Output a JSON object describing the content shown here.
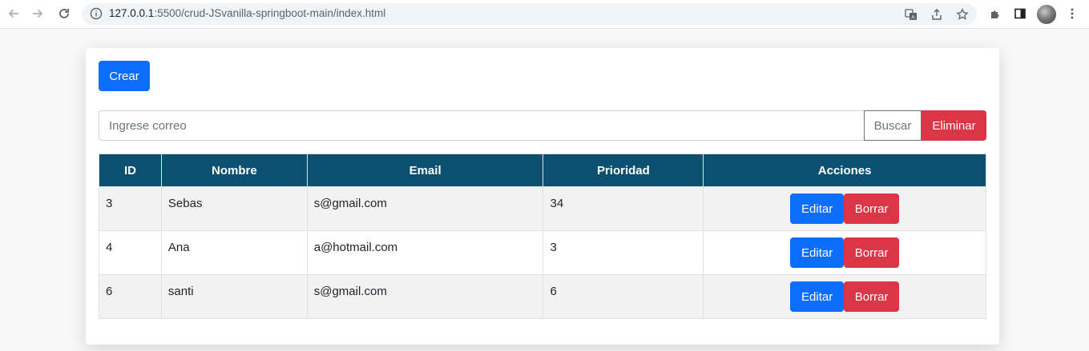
{
  "browser": {
    "url_host": "127.0.0.1",
    "url_rest": ":5500/crud-JSvanilla-springboot-main/index.html"
  },
  "toolbar": {
    "crear_label": "Crear"
  },
  "search": {
    "placeholder": "Ingrese correo",
    "buscar_label": "Buscar",
    "eliminar_label": "Eliminar"
  },
  "table": {
    "headers": [
      "ID",
      "Nombre",
      "Email",
      "Prioridad",
      "Acciones"
    ],
    "rows": [
      {
        "id": "3",
        "nombre": "Sebas",
        "email": "s@gmail.com",
        "prioridad": "34"
      },
      {
        "id": "4",
        "nombre": "Ana",
        "email": "a@hotmail.com",
        "prioridad": "3"
      },
      {
        "id": "6",
        "nombre": "santi",
        "email": "s@gmail.com",
        "prioridad": "6"
      }
    ],
    "editar_label": "Editar",
    "borrar_label": "Borrar"
  },
  "colors": {
    "primary": "#0d6efd",
    "danger": "#dc3545",
    "header": "#0b5070"
  },
  "icons": [
    "back-arrow-icon",
    "forward-arrow-icon",
    "reload-icon",
    "info-icon",
    "translate-icon",
    "share-icon",
    "star-icon",
    "extensions-icon",
    "side-panel-icon",
    "profile-avatar",
    "menu-dots-icon"
  ]
}
